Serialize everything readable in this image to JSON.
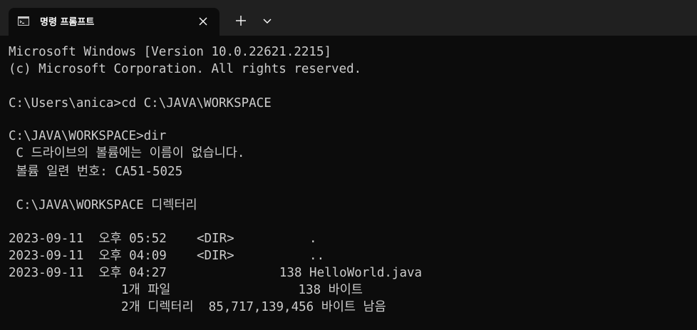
{
  "tab": {
    "title": "명령 프롬프트",
    "icon": "command-prompt-icon"
  },
  "toolbar": {
    "new_tab_icon": "plus-icon",
    "dropdown_icon": "chevron-down-icon"
  },
  "terminal": {
    "text_color": "#cccccc",
    "background_color": "#0c0c0c",
    "lines": [
      "Microsoft Windows [Version 10.0.22621.2215]",
      "(c) Microsoft Corporation. All rights reserved.",
      "",
      "C:\\Users\\anica>cd C:\\JAVA\\WORKSPACE",
      "",
      "C:\\JAVA\\WORKSPACE>dir",
      " C 드라이브의 볼륨에는 이름이 없습니다.",
      " 볼륨 일련 번호: CA51-5025",
      "",
      " C:\\JAVA\\WORKSPACE 디렉터리",
      "",
      "2023-09-11  오후 05:52    <DIR>          .",
      "2023-09-11  오후 04:09    <DIR>          ..",
      "2023-09-11  오후 04:27               138 HelloWorld.java",
      "               1개 파일                 138 바이트",
      "               2개 디렉터리  85,717,139,456 바이트 남음"
    ]
  }
}
